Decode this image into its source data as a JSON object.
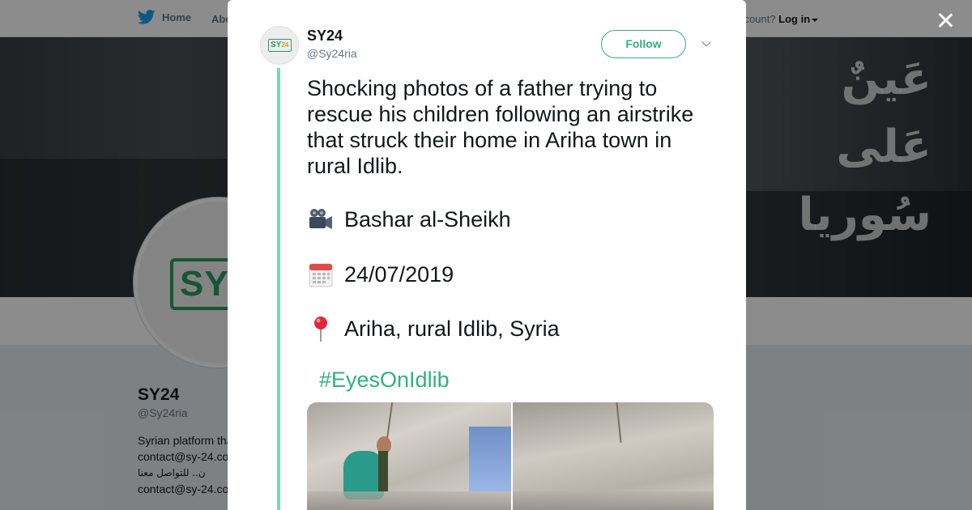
{
  "background": {
    "nav": {
      "home_label": "Home",
      "about_label": "Abo",
      "login_prompt": "ccount?",
      "login_label": "Log in"
    },
    "banner_arabic": [
      "عَينٌ",
      "عَلى",
      "سُوريا"
    ],
    "profile": {
      "name": "SY24",
      "handle": "@Sy24ria",
      "bio_lines": [
        "Syrian platform tha",
        "contact@sy-24.co",
        "ن.. للتواصل معنا",
        "contact@sy-24.co"
      ]
    },
    "avatar_logo_text": "SY"
  },
  "tweet": {
    "author_name": "SY24",
    "author_handle": "@Sy24ria",
    "avatar_logo_text": "SY",
    "avatar_logo_accent": "24",
    "follow_label": "Follow",
    "text": "Shocking photos of a father trying to rescue his children following an airstrike that struck their home in Ariha town in rural Idlib.",
    "lines": [
      {
        "icon": "movie-camera-icon",
        "text": "Bashar al-Sheikh"
      },
      {
        "icon": "calendar-icon",
        "text": "24/07/2019"
      },
      {
        "icon": "round-pushpin-icon",
        "text": "Ariha, rural Idlib, Syria"
      }
    ],
    "hashtag": "#EyesOnIdlib"
  },
  "colors": {
    "accent": "#2fb27c",
    "thread_line": "#7fd3b1",
    "twitter_blue": "#1da1f2"
  }
}
